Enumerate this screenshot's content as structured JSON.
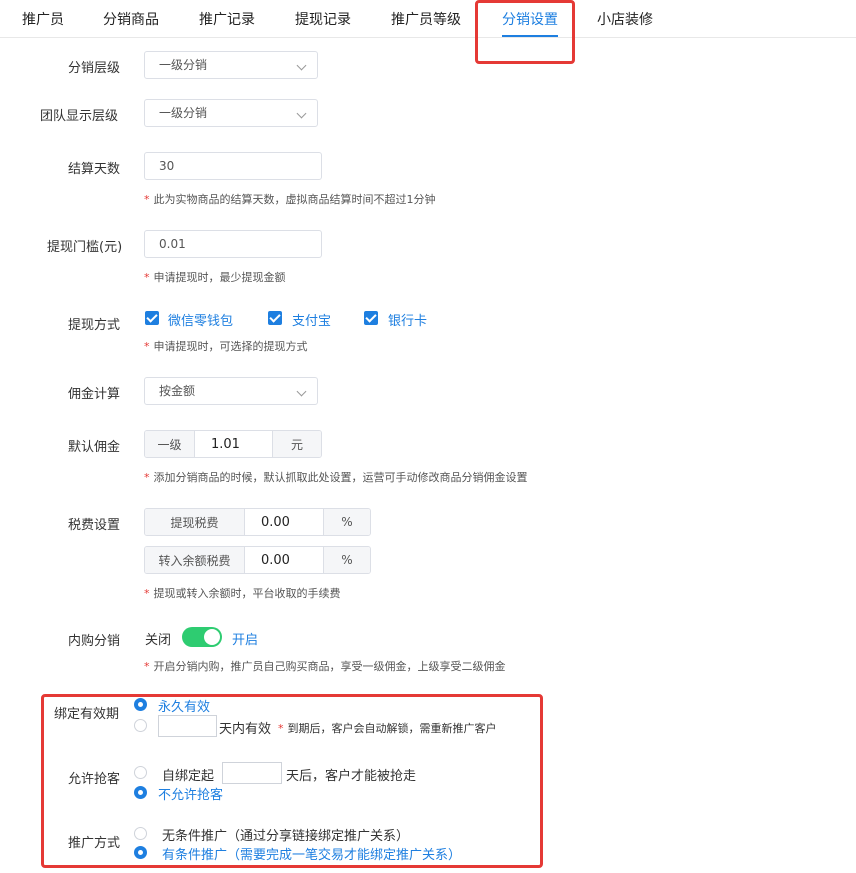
{
  "tabs": [
    {
      "label": "推广员"
    },
    {
      "label": "分销商品"
    },
    {
      "label": "推广记录"
    },
    {
      "label": "提现记录"
    },
    {
      "label": "推广员等级"
    },
    {
      "label": "分销设置"
    },
    {
      "label": "小店装修"
    }
  ],
  "active_tab": "分销设置",
  "form": {
    "distribution_level": {
      "label": "分销层级",
      "value": "一级分销"
    },
    "team_display_level": {
      "label": "团队显示层级",
      "value": "一级分销"
    },
    "settlement_days": {
      "label": "结算天数",
      "value": "30",
      "note": "此为实物商品的结算天数，虚拟商品结算时间不超过1分钟"
    },
    "withdraw_threshold": {
      "label": "提现门槛(元)",
      "value": "0.01",
      "note": "申请提现时，最少提现金额"
    },
    "withdraw_method": {
      "label": "提现方式",
      "options": [
        {
          "label": "微信零钱包",
          "checked": true
        },
        {
          "label": "支付宝",
          "checked": true
        },
        {
          "label": "银行卡",
          "checked": true
        }
      ],
      "note": "申请提现时，可选择的提现方式"
    },
    "commission_calc": {
      "label": "佣金计算",
      "value": "按金额"
    },
    "default_commission": {
      "label": "默认佣金",
      "prefix": "一级",
      "value": "1.01",
      "suffix": "元",
      "note": "添加分销商品的时候，默认抓取此处设置，运营可手动修改商品分销佣金设置"
    },
    "tax": {
      "label": "税费设置",
      "withdraw": {
        "prefix": "提现税费",
        "value": "0.00",
        "suffix": "%"
      },
      "transfer": {
        "prefix": "转入余额税费",
        "value": "0.00",
        "suffix": "%"
      },
      "note": "提现或转入余额时，平台收取的手续费"
    },
    "internal_purchase": {
      "label": "内购分销",
      "off_label": "关闭",
      "on_label": "开启",
      "enabled": true,
      "note": "开启分销内购，推广员自己购买商品，享受一级佣金，上级享受二级佣金"
    },
    "binding_validity": {
      "label": "绑定有效期",
      "option_permanent": "永久有效",
      "option_days_suffix": "天内有效",
      "option_days_note": "到期后，客户会自动解锁，需重新推广客户",
      "selected": "permanent"
    },
    "allow_snatch": {
      "label": "允许抢客",
      "option_after_prefix": "自绑定起",
      "option_after_suffix": "天后，客户才能被抢走",
      "option_no": "不允许抢客",
      "selected": "no"
    },
    "promotion_mode": {
      "label": "推广方式",
      "option_unconditional": "无条件推广（通过分享链接绑定推广关系）",
      "option_conditional": "有条件推广（需要完成一笔交易才能绑定推广关系）",
      "selected": "conditional"
    }
  },
  "colors": {
    "accent": "#1e7fe0",
    "highlight_box": "#e53935",
    "switch_on": "#2ecc71"
  }
}
